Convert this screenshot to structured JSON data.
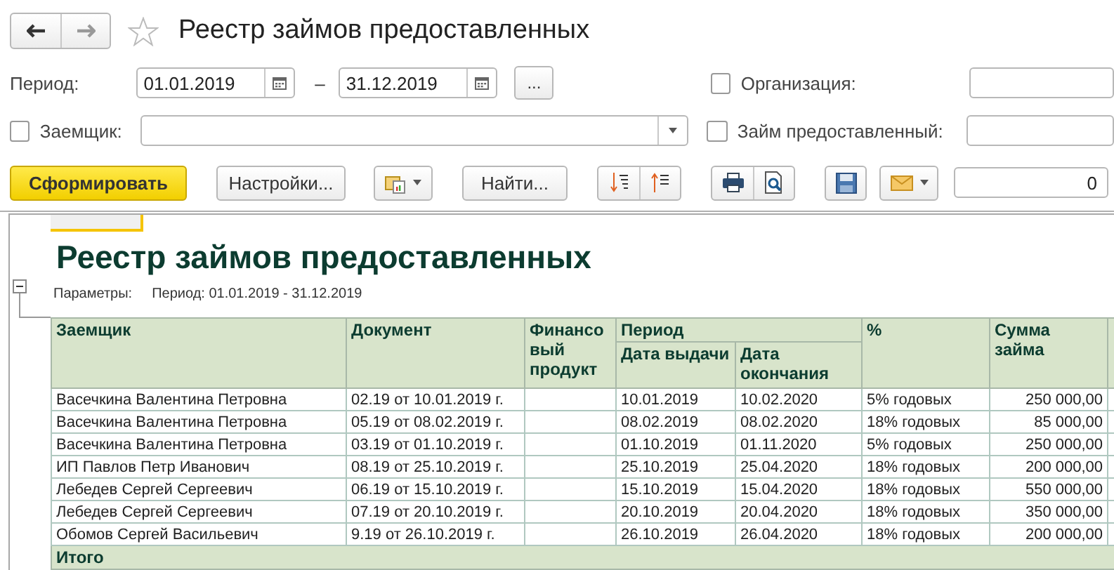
{
  "window": {
    "title": "Реестр займов предоставленных"
  },
  "filters": {
    "period": {
      "label": "Период:",
      "from": "01.01.2019",
      "dash": "–",
      "to": "31.12.2019",
      "choose_button": "..."
    },
    "organization": {
      "label": "Организация:",
      "checked": false
    },
    "borrower": {
      "label": "Заемщик:",
      "checked": false
    },
    "loan": {
      "label": "Займ предоставленный:",
      "checked": false
    }
  },
  "toolbar": {
    "generate": "Сформировать",
    "settings": "Настройки...",
    "find": "Найти...",
    "counter": "0"
  },
  "report": {
    "title": "Реестр займов предоставленных",
    "params_label": "Параметры:",
    "params_value": "Период: 01.01.2019 - 31.12.2019",
    "header_rows": [
      [
        {
          "label": "Заемщик",
          "rowspan": 2
        },
        {
          "label": "Документ",
          "rowspan": 2
        },
        {
          "label": "Финансовый продукт",
          "rowspan": 2
        },
        {
          "label": "Период",
          "colspan": 2
        },
        {
          "label": "%",
          "rowspan": 2
        },
        {
          "label": "Сумма займа",
          "rowspan": 2
        }
      ],
      [
        {
          "label": "Дата выдачи"
        },
        {
          "label": "Дата окончания"
        }
      ]
    ],
    "rows": [
      [
        "Васечкина Валентина Петровна",
        "02.19 от 10.01.2019 г.",
        "",
        "10.01.2019",
        "10.02.2020",
        "5% годовых",
        "250 000,00"
      ],
      [
        "Васечкина Валентина Петровна",
        "05.19 от 08.02.2019 г.",
        "",
        "08.02.2019",
        "08.02.2020",
        "18% годовых",
        "85 000,00"
      ],
      [
        "Васечкина Валентина Петровна",
        "03.19 от 01.10.2019 г.",
        "",
        "01.10.2019",
        "01.11.2020",
        "5% годовых",
        "250 000,00"
      ],
      [
        "ИП Павлов Петр Иванович",
        "08.19 от 25.10.2019 г.",
        "",
        "25.10.2019",
        "25.04.2020",
        "18% годовых",
        "200 000,00"
      ],
      [
        "Лебедев Сергей Сергеевич",
        "06.19 от 15.10.2019 г.",
        "",
        "15.10.2019",
        "15.04.2020",
        "18% годовых",
        "550 000,00"
      ],
      [
        "Лебедев Сергей Сергеевич",
        "07.19 от 20.10.2019 г.",
        "",
        "20.10.2019",
        "20.04.2020",
        "18% годовых",
        "350 000,00"
      ],
      [
        "Обомов Сергей Васильевич",
        "9.19 от 26.10.2019 г.",
        "",
        "26.10.2019",
        "26.04.2020",
        "18% годовых",
        "200 000,00"
      ]
    ],
    "total_label": "Итого"
  }
}
